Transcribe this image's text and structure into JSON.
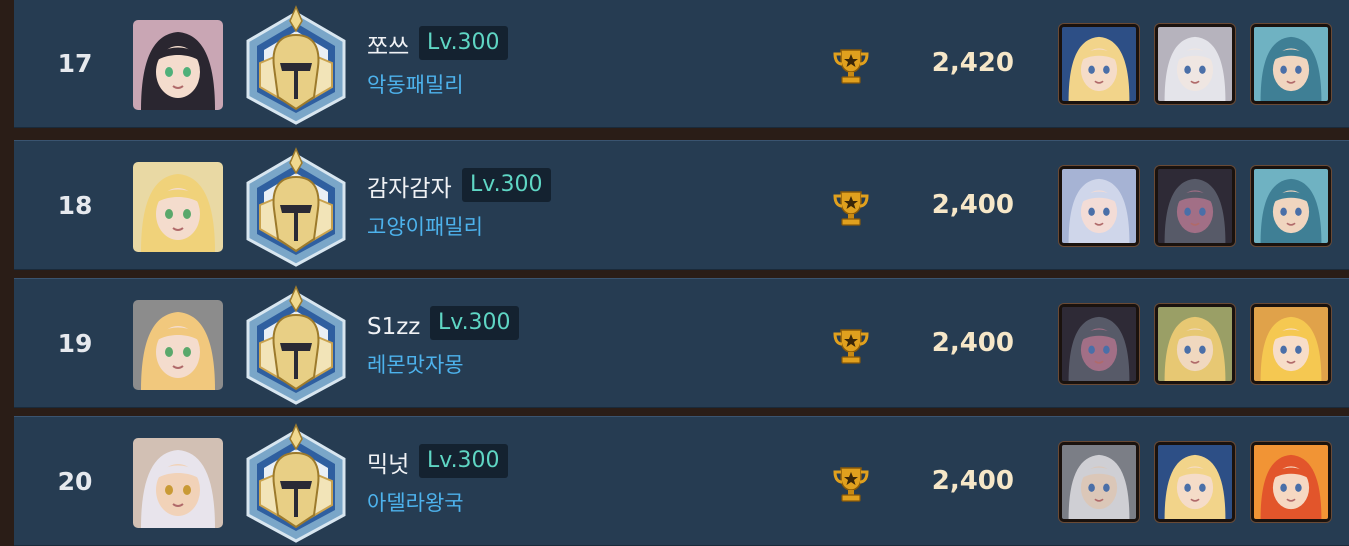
{
  "ranking": {
    "rows": [
      {
        "rank": "17",
        "name": "쪼쓰",
        "level": "Lv.300",
        "guild": "악동패밀리",
        "score": "2,420",
        "portrait": {
          "hair": "#2a2630",
          "skin": "#f4dccd",
          "bg": "#c9a6b4",
          "eye": "#4fb07a"
        },
        "heroes": [
          {
            "hair": "#f2d48a",
            "skin": "#f5dcc8",
            "bg": "#2d4f86"
          },
          {
            "hair": "#e4e4ea",
            "skin": "#efe6e2",
            "bg": "#b6b3bd"
          },
          {
            "hair": "#3f7f95",
            "skin": "#f0d5bf",
            "bg": "#6fb2c2"
          }
        ]
      },
      {
        "rank": "18",
        "name": "감자감자",
        "level": "Lv.300",
        "guild": "고양이패밀리",
        "score": "2,400",
        "portrait": {
          "hair": "#f0d27a",
          "skin": "#f4dccd",
          "bg": "#e9d9a4",
          "eye": "#5aa86b"
        },
        "heroes": [
          {
            "hair": "#cfd6ea",
            "skin": "#f3dcd6",
            "bg": "#a6b3d4"
          },
          {
            "hair": "#575a68",
            "skin": "#a26f86",
            "bg": "#2e2a36"
          },
          {
            "hair": "#3f7f95",
            "skin": "#f0d5bf",
            "bg": "#6fb2c2"
          }
        ]
      },
      {
        "rank": "19",
        "name": "S1zz",
        "level": "Lv.300",
        "guild": "레몬맛자몽",
        "score": "2,400",
        "portrait": {
          "hair": "#f1c87d",
          "skin": "#f4dccd",
          "bg": "#8c8c8c",
          "eye": "#5aa86b"
        },
        "heroes": [
          {
            "hair": "#575a68",
            "skin": "#a26f86",
            "bg": "#2e2a36"
          },
          {
            "hair": "#e7c873",
            "skin": "#f0d8bf",
            "bg": "#9a9f66"
          },
          {
            "hair": "#f5c851",
            "skin": "#f7ddc8",
            "bg": "#e0a24a"
          }
        ]
      },
      {
        "rank": "20",
        "name": "믹넛",
        "level": "Lv.300",
        "guild": "아델라왕국",
        "score": "2,400",
        "portrait": {
          "hair": "#e8e4ec",
          "skin": "#f1d2b8",
          "bg": "#d2c0b4",
          "eye": "#c99a35"
        },
        "heroes": [
          {
            "hair": "#cfcfd4",
            "skin": "#dbc7b8",
            "bg": "#7b7e86"
          },
          {
            "hair": "#f2d48a",
            "skin": "#f5dcc8",
            "bg": "#2d4f86"
          },
          {
            "hair": "#e2552b",
            "skin": "#f6d8c2",
            "bg": "#f19435"
          }
        ]
      }
    ]
  },
  "icons": {
    "badge": "knight-helmet-rank-badge",
    "cup": "trophy-icon"
  },
  "colors": {
    "row_bg": "#263c52",
    "level_text": "#5fd6c4",
    "guild_text": "#4db2ec",
    "score_text": "#f6e7c8",
    "trophy": "#e0a01e"
  }
}
